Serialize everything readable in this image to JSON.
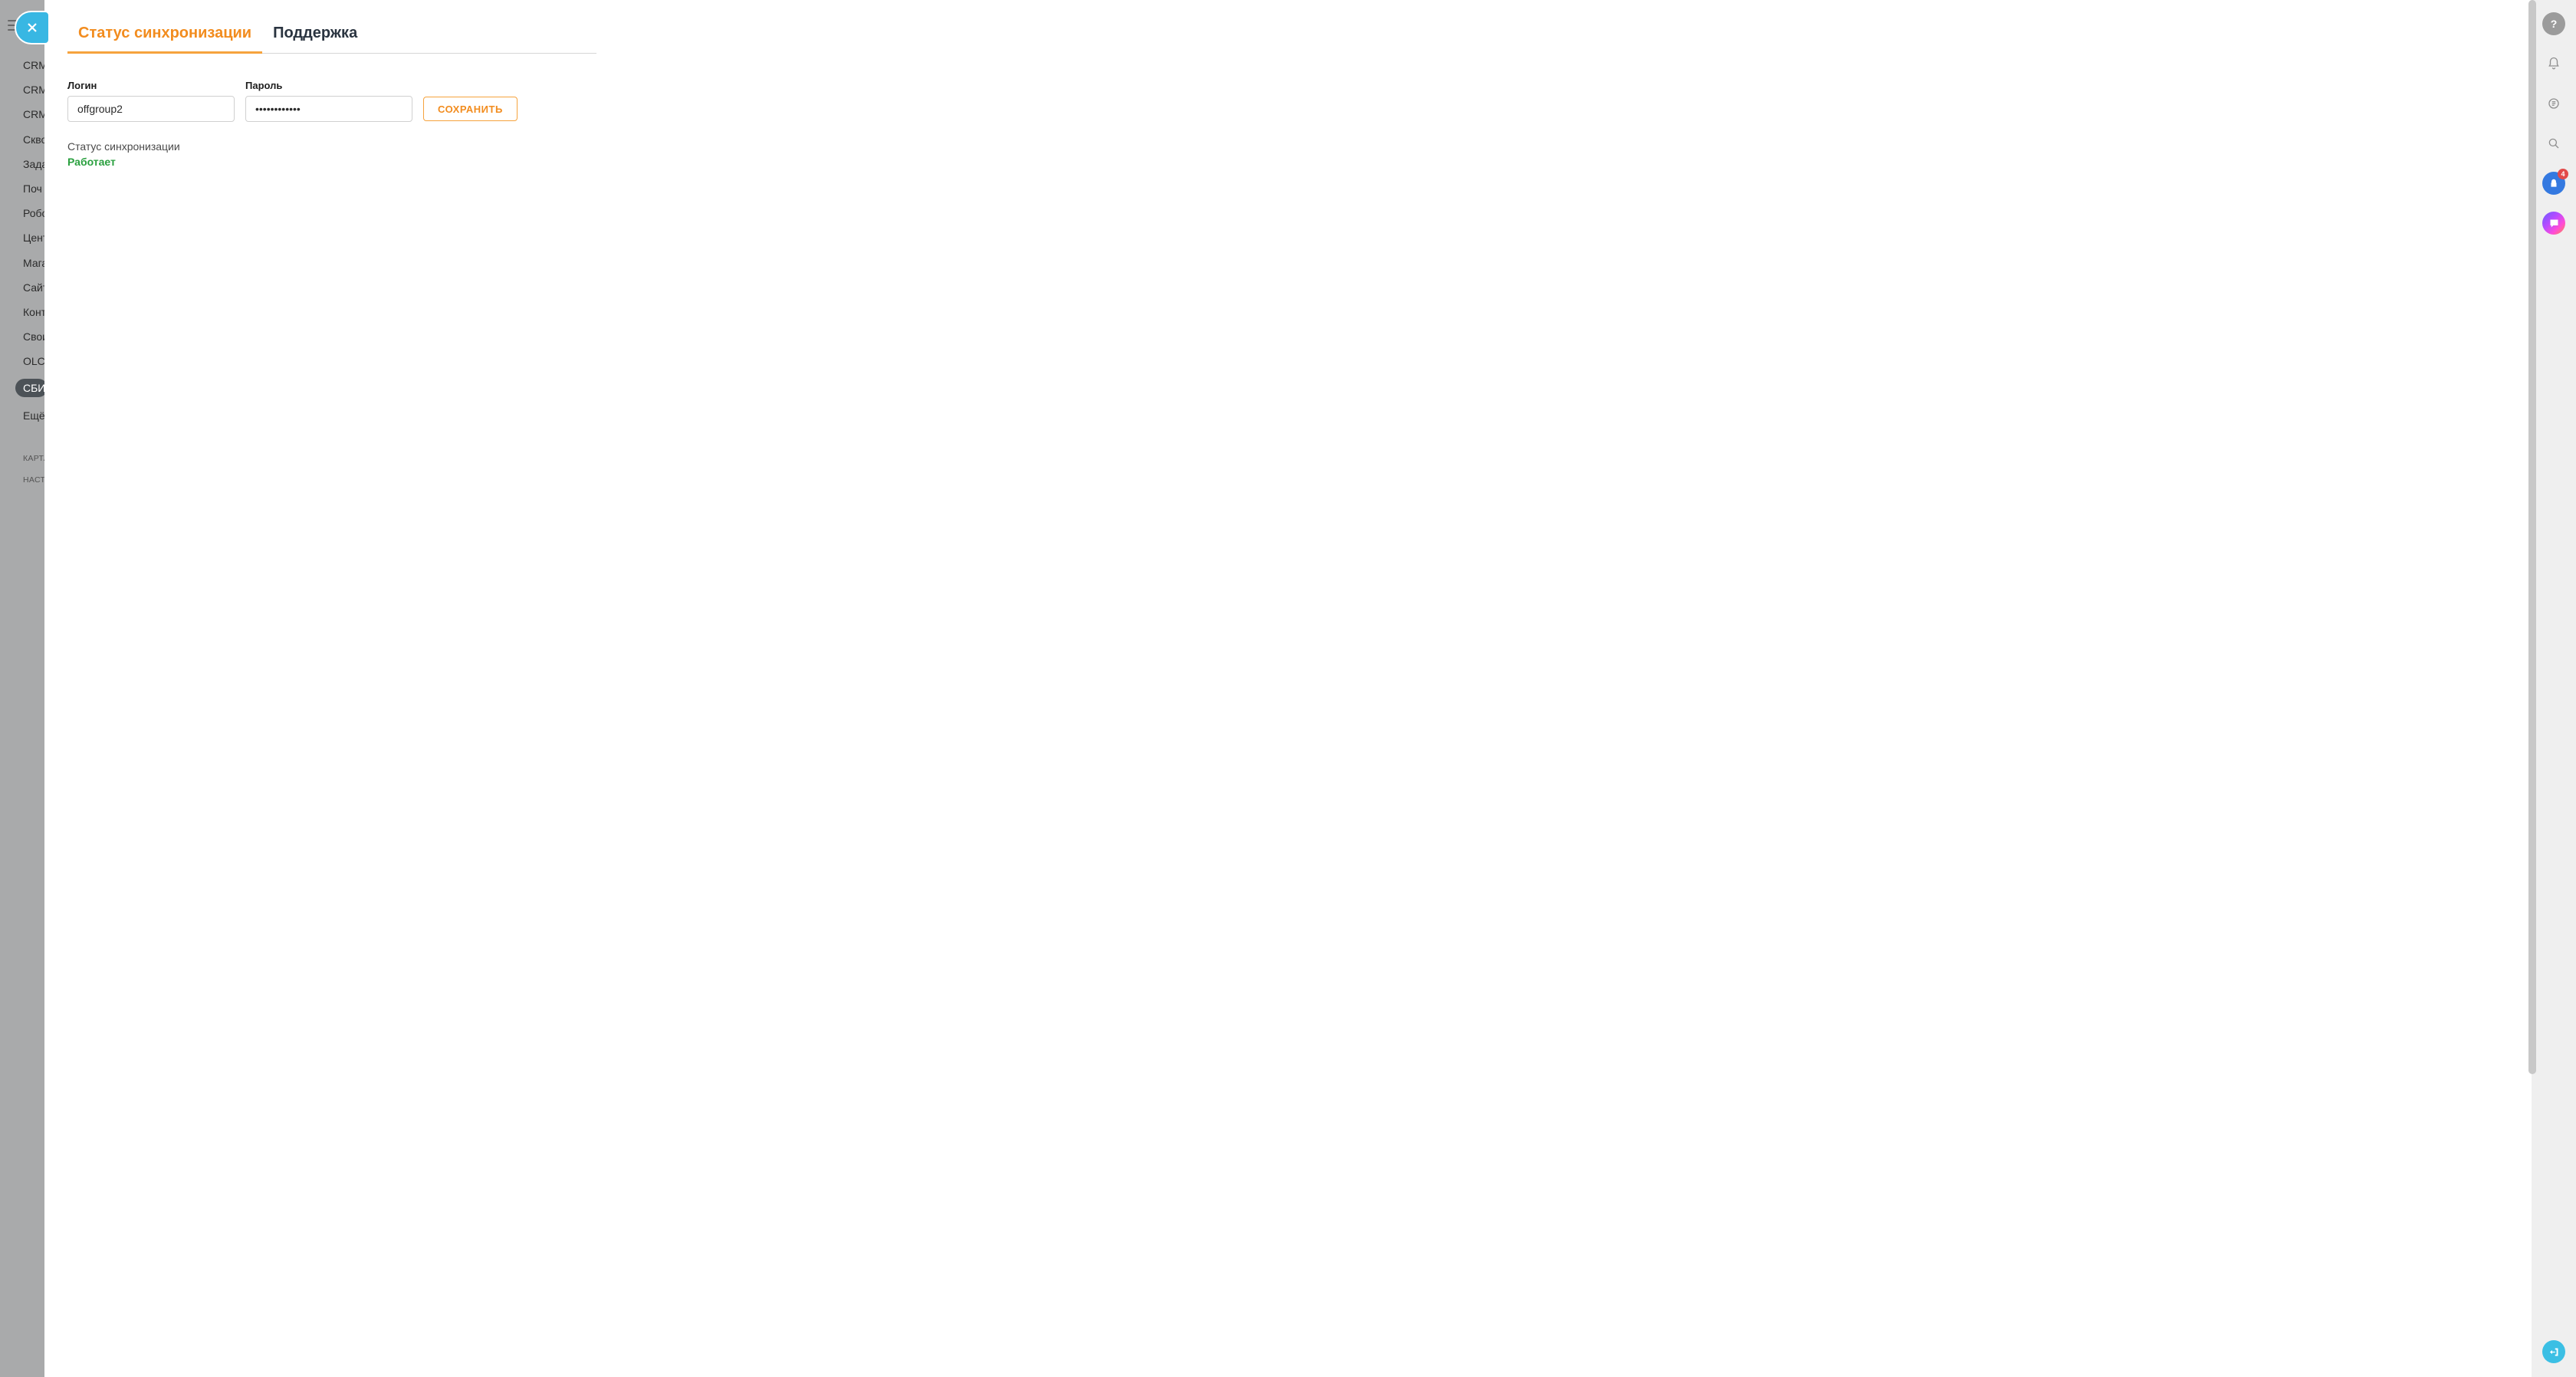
{
  "sidebar": {
    "items": [
      "CRM",
      "CRM",
      "CRM",
      "Скво",
      "Зада",
      "Поч",
      "Робо",
      "Цент",
      "Мага",
      "Сайт",
      "Конт",
      "Свои",
      "OLCl",
      "СБИ",
      "Ещё"
    ],
    "small1": "КАРТА",
    "small2": "НАСТР"
  },
  "tabs": {
    "sync": "Статус синхронизации",
    "support": "Поддержка"
  },
  "form": {
    "login_label": "Логин",
    "login_value": "offgroup2",
    "password_label": "Пароль",
    "password_value": "••••••••••••",
    "save": "СОХРАНИТЬ"
  },
  "status": {
    "title": "Статус синхронизации",
    "value": "Работает"
  },
  "rail": {
    "badge": "4"
  }
}
